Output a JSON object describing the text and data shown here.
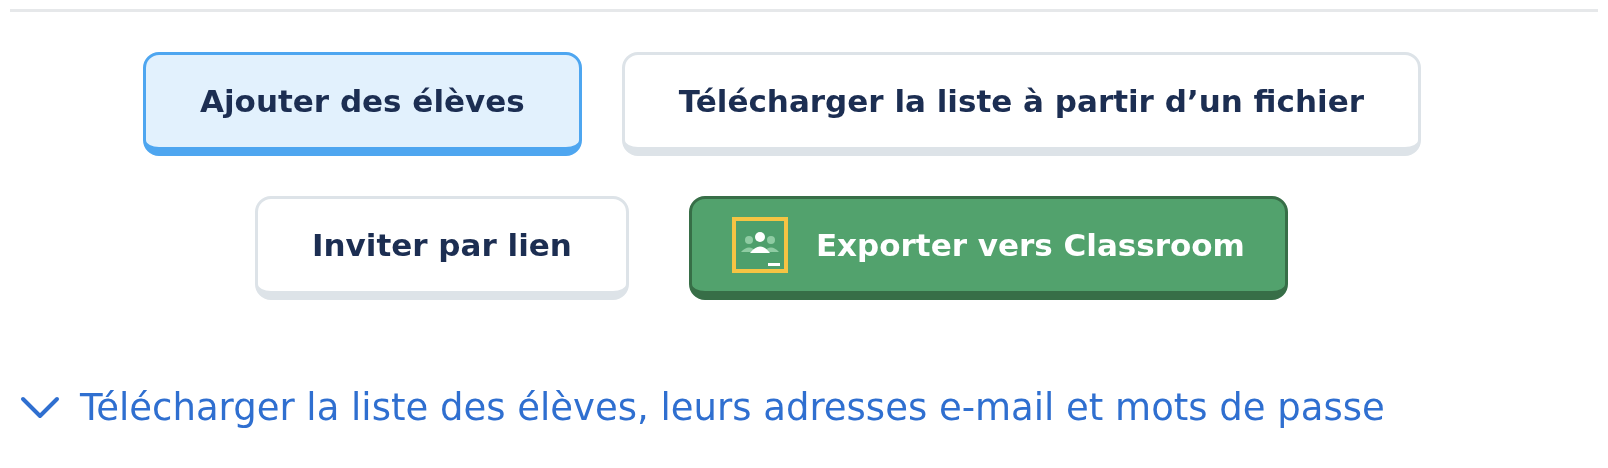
{
  "button_rows": [
    {
      "buttons": [
        {
          "label": "Ajouter des élèves",
          "kind": "plain",
          "selected": true
        },
        {
          "label": "Télécharger la liste à partir d’un fichier",
          "kind": "plain",
          "selected": false
        }
      ]
    },
    {
      "buttons": [
        {
          "label": "Inviter par lien",
          "kind": "plain",
          "selected": false
        },
        {
          "label": "Exporter vers Classroom",
          "kind": "classroom",
          "selected": false
        }
      ]
    }
  ],
  "download_link": {
    "label": "Télécharger la liste des élèves, leurs adresses e-mail et mots de passe",
    "expanded": false
  }
}
